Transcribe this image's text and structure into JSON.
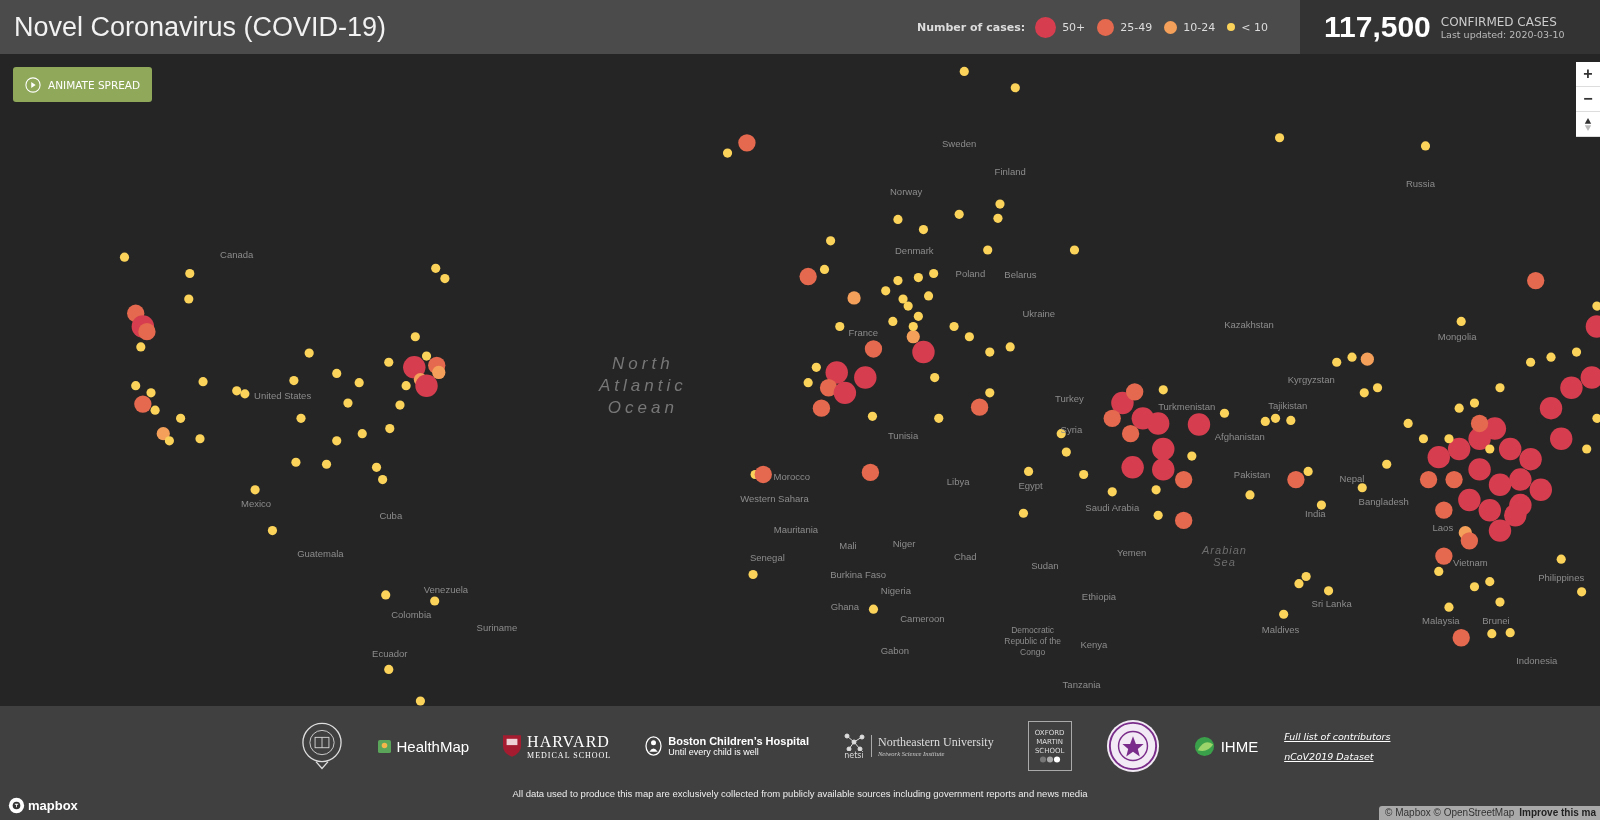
{
  "header": {
    "title": "Novel Coronavirus (COVID-19)",
    "legend_label": "Number of cases:",
    "legend": [
      {
        "label": "50+",
        "color": "#d63e4f"
      },
      {
        "label": "25-49",
        "color": "#e5694e"
      },
      {
        "label": "10-24",
        "color": "#f5a05a"
      },
      {
        "label": "< 10",
        "color": "#fbd35a"
      }
    ],
    "total": "117,500",
    "total_label": "CONFIRMED CASES",
    "updated": "Last updated: 2020-03-10"
  },
  "animate_button": "ANIMATE SPREAD",
  "zoom_controls": [
    "+",
    "−"
  ],
  "map_labels": [
    {
      "text": "Canada",
      "kind": "country"
    },
    {
      "text": "United States",
      "kind": "country"
    },
    {
      "text": "Mexico",
      "kind": "country"
    },
    {
      "text": "Cuba",
      "kind": "country"
    },
    {
      "text": "Guatemala",
      "kind": "country"
    },
    {
      "text": "Venezuela",
      "kind": "country"
    },
    {
      "text": "Colombia",
      "kind": "country"
    },
    {
      "text": "Suriname",
      "kind": "country"
    },
    {
      "text": "Ecuador",
      "kind": "country"
    },
    {
      "text": "North Atlantic Ocean",
      "kind": "ocean"
    },
    {
      "text": "Norway",
      "kind": "country"
    },
    {
      "text": "Sweden",
      "kind": "country"
    },
    {
      "text": "Finland",
      "kind": "country"
    },
    {
      "text": "Russia",
      "kind": "country"
    },
    {
      "text": "Denmark",
      "kind": "country"
    },
    {
      "text": "Poland",
      "kind": "country"
    },
    {
      "text": "Belarus",
      "kind": "country"
    },
    {
      "text": "Ukraine",
      "kind": "country"
    },
    {
      "text": "France",
      "kind": "country"
    },
    {
      "text": "Kazakhstan",
      "kind": "country"
    },
    {
      "text": "Mongolia",
      "kind": "country"
    },
    {
      "text": "Turkmenistan",
      "kind": "country"
    },
    {
      "text": "Kyrgyzstan",
      "kind": "country"
    },
    {
      "text": "Tajikistan",
      "kind": "country"
    },
    {
      "text": "Turkey",
      "kind": "country"
    },
    {
      "text": "Syria",
      "kind": "country"
    },
    {
      "text": "Afghanistan",
      "kind": "country"
    },
    {
      "text": "Pakistan",
      "kind": "country"
    },
    {
      "text": "Nepal",
      "kind": "country"
    },
    {
      "text": "Bangladesh",
      "kind": "country"
    },
    {
      "text": "India",
      "kind": "country"
    },
    {
      "text": "Morocco",
      "kind": "country"
    },
    {
      "text": "Tunisia",
      "kind": "country"
    },
    {
      "text": "Libya",
      "kind": "country"
    },
    {
      "text": "Egypt",
      "kind": "country"
    },
    {
      "text": "Saudi Arabia",
      "kind": "country"
    },
    {
      "text": "Western Sahara",
      "kind": "country"
    },
    {
      "text": "Mauritania",
      "kind": "country"
    },
    {
      "text": "Senegal",
      "kind": "country"
    },
    {
      "text": "Mali",
      "kind": "country"
    },
    {
      "text": "Niger",
      "kind": "country"
    },
    {
      "text": "Chad",
      "kind": "country"
    },
    {
      "text": "Sudan",
      "kind": "country"
    },
    {
      "text": "Yemen",
      "kind": "country"
    },
    {
      "text": "Arabian Sea",
      "kind": "sea"
    },
    {
      "text": "Burkina Faso",
      "kind": "country"
    },
    {
      "text": "Nigeria",
      "kind": "country"
    },
    {
      "text": "Ethiopia",
      "kind": "country"
    },
    {
      "text": "Ghana",
      "kind": "country"
    },
    {
      "text": "Cameroon",
      "kind": "country"
    },
    {
      "text": "Democratic Republic of the Congo",
      "kind": "region"
    },
    {
      "text": "Kenya",
      "kind": "country"
    },
    {
      "text": "Tanzania",
      "kind": "country"
    },
    {
      "text": "Gabon",
      "kind": "country"
    },
    {
      "text": "Sri Lanka",
      "kind": "country"
    },
    {
      "text": "Maldives",
      "kind": "country"
    },
    {
      "text": "Vietnam",
      "kind": "country"
    },
    {
      "text": "Philippines",
      "kind": "country"
    },
    {
      "text": "Malaysia",
      "kind": "country"
    },
    {
      "text": "Brunei",
      "kind": "country"
    },
    {
      "text": "Indonesia",
      "kind": "country"
    },
    {
      "text": "Laos",
      "kind": "country"
    }
  ],
  "footer": {
    "healthmap": "HealthMap",
    "harvard": "HARVARD",
    "harvard_sub": "MEDICAL SCHOOL",
    "boston": "Boston Children’s Hospital",
    "boston_sub": "Until every child is well",
    "netsi": "netsi",
    "northeastern": "Northeastern University",
    "northeastern_sub": "Network Science Institute",
    "oxford_martin": [
      "OXFORD",
      "MARTIN",
      "SCHOOL"
    ],
    "ihme": "IHME",
    "links": [
      "Full list of contributors",
      "nCoV2019 Dataset"
    ],
    "disclaimer": "All data used to produce this map are exclusively collected from publicly available sources including government reports and news media"
  },
  "mapbox_logo": "mapbox",
  "attribution": {
    "text": "© Mapbox © OpenStreetMap",
    "link": "Improve this ma"
  }
}
